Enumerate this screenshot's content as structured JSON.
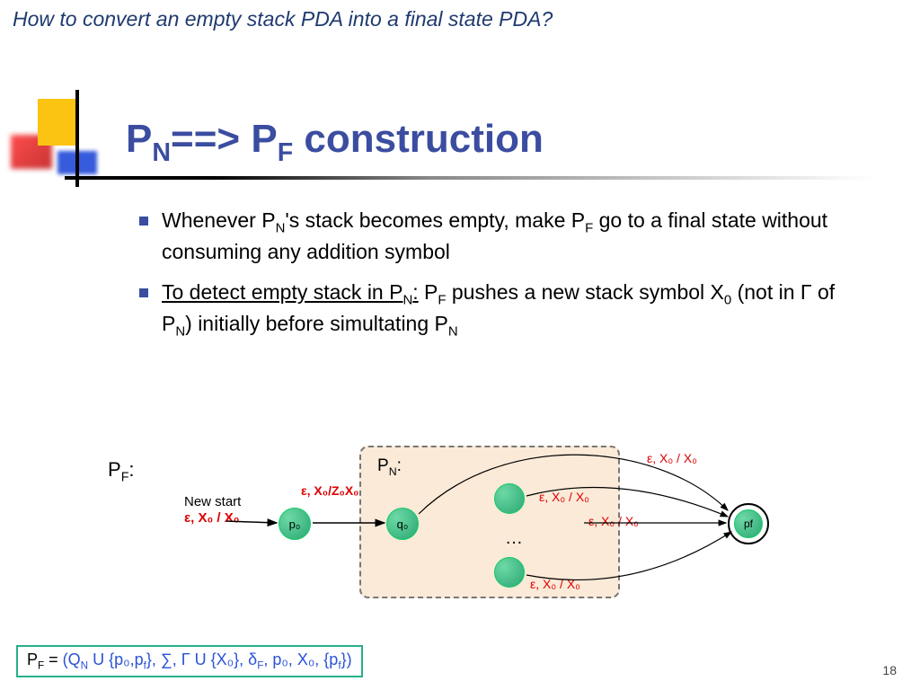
{
  "top_question": "How to convert an empty stack PDA into a final state PDA?",
  "title_prefix": "P",
  "title_sub1": "N",
  "title_mid": "==> P",
  "title_sub2": "F",
  "title_suffix": " construction",
  "bullet1_a": "Whenever P",
  "bullet1_b": "'s stack becomes empty, make P",
  "bullet1_c": " go to a final state without consuming any addition symbol",
  "bullet2_a": "To detect empty stack in P",
  "bullet2_b": ":",
  "bullet2_c": " P",
  "bullet2_d": " pushes a new stack symbol X",
  "bullet2_e": " (not in Γ of P",
  "bullet2_f": ") initially before simultating P",
  "subN": "N",
  "subF": "F",
  "sub0": "0",
  "pf_label_a": "P",
  "pf_label_b": ":",
  "pn_label_a": "P",
  "pn_label_b": ":",
  "new_start": "New start",
  "eps_x0_x0": "ε, X₀ / X₀",
  "eps_x0_z0x0": "ε, X₀/Z₀X₀",
  "state_p0": "p₀",
  "state_q0": "q₀",
  "state_pf": "pf",
  "ellipsis": "…",
  "formula_a": "P",
  "formula_b": " = ",
  "formula_c": "(Q",
  "formula_d": " U {p₀,p",
  "formula_e": "}, ∑, Γ U {X₀}, δ",
  "formula_f": ", p₀, X₀, {p",
  "formula_g": "})",
  "sub_f": "f",
  "pagenum": "18"
}
